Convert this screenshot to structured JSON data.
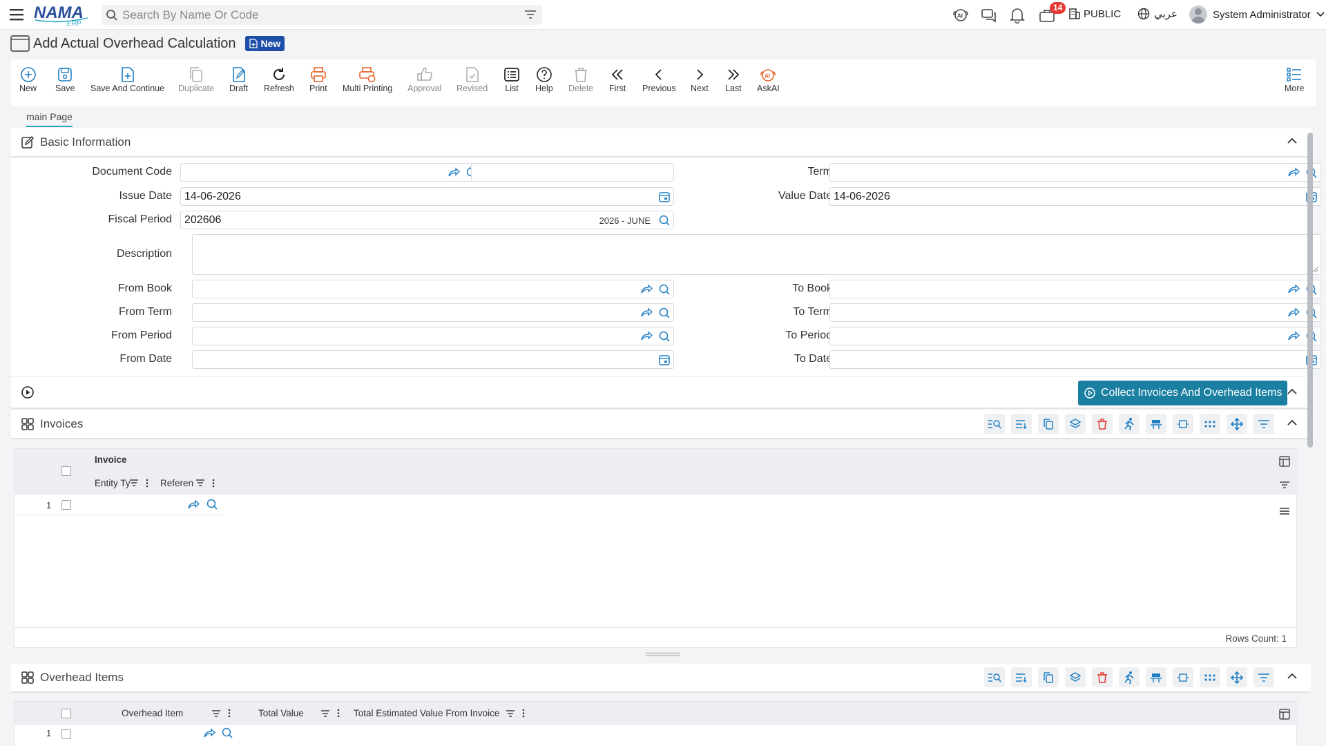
{
  "topbar": {
    "search_placeholder": "Search By Name Or Code",
    "notification_count": "14",
    "public_label": "PUBLIC",
    "language_label": "عربي",
    "user_name": "System Administrator"
  },
  "page": {
    "title": "Add Actual Overhead Calculation",
    "status_badge": "New"
  },
  "toolbar": {
    "new": "New",
    "save": "Save",
    "save_continue": "Save And Continue",
    "duplicate": "Duplicate",
    "draft": "Draft",
    "refresh": "Refresh",
    "print": "Print",
    "multi_printing": "Multi Printing",
    "approval": "Approval",
    "revised": "Revised",
    "list": "List",
    "help": "Help",
    "delete": "Delete",
    "first": "First",
    "previous": "Previous",
    "next": "Next",
    "last": "Last",
    "askai": "AskAI",
    "more": "More"
  },
  "tabs": {
    "main": "main Page"
  },
  "basic_info": {
    "title": "Basic Information",
    "document_code_label": "Document Code",
    "document_code": "",
    "term_label": "Term",
    "issue_date_label": "Issue Date",
    "issue_date": "14-06-2026",
    "value_date_label": "Value Date",
    "value_date": "14-06-2026",
    "fiscal_period_label": "Fiscal Period",
    "fiscal_period": "202606",
    "fiscal_period_desc": "2026 - JUNE",
    "description_label": "Description",
    "from_book_label": "From Book",
    "to_book_label": "To Book",
    "from_term_label": "From Term",
    "to_term_label": "To Term",
    "from_period_label": "From Period",
    "to_period_label": "To Period",
    "from_date_label": "From Date",
    "to_date_label": "To Date"
  },
  "actions": {
    "collect_label": "Collect Invoices And Overhead Items"
  },
  "invoices": {
    "title": "Invoices",
    "group_header": "Invoice",
    "col_entity_type": "Entity Ty",
    "col_reference": "Referen",
    "rows": [
      {
        "num": "1"
      }
    ],
    "rows_count": "Rows Count: 1"
  },
  "overhead_items": {
    "title": "Overhead Items",
    "col_overhead_item": "Overhead Item",
    "col_total_value": "Total Value",
    "col_total_estimated": "Total Estimated Value From Invoice",
    "rows": [
      {
        "num": "1"
      }
    ]
  },
  "colors": {
    "accent": "#27a6c9",
    "brand_blue": "#1e4fa8",
    "action_teal": "#1a7fa0",
    "danger": "#e53935",
    "print_orange": "#e8632b"
  }
}
